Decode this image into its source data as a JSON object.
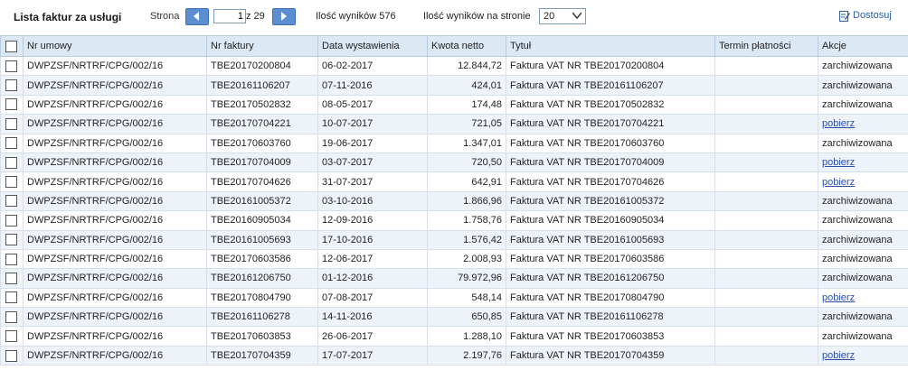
{
  "toolbar": {
    "title": "Lista faktur za usługi",
    "page_label": "Strona",
    "page_value": "1",
    "page_of": "z 29",
    "results": "Ilość wyników 576",
    "per_page_label": "Ilość wyników na stronie",
    "per_page_value": "20",
    "customize_label": "Dostosuj"
  },
  "columns": [
    "Nr umowy",
    "Nr faktury",
    "Data wystawienia",
    "Kwota netto",
    "Tytuł",
    "Termin płatności",
    "Akcje"
  ],
  "rows": [
    {
      "umowa": "DWPZSF/NRTRF/CPG/002/16",
      "faktura": "TBE20170200804",
      "data": "06-02-2017",
      "kwota": "12.844,72",
      "tytul": "Faktura VAT NR TBE20170200804",
      "termin": "",
      "akcja": "zarchiwizowana",
      "link": false
    },
    {
      "umowa": "DWPZSF/NRTRF/CPG/002/16",
      "faktura": "TBE20161106207",
      "data": "07-11-2016",
      "kwota": "424,01",
      "tytul": "Faktura VAT NR TBE20161106207",
      "termin": "",
      "akcja": "zarchiwizowana",
      "link": false
    },
    {
      "umowa": "DWPZSF/NRTRF/CPG/002/16",
      "faktura": "TBE20170502832",
      "data": "08-05-2017",
      "kwota": "174,48",
      "tytul": "Faktura VAT NR TBE20170502832",
      "termin": "",
      "akcja": "zarchiwizowana",
      "link": false
    },
    {
      "umowa": "DWPZSF/NRTRF/CPG/002/16",
      "faktura": "TBE20170704221",
      "data": "10-07-2017",
      "kwota": "721,05",
      "tytul": "Faktura VAT NR TBE20170704221",
      "termin": "",
      "akcja": "pobierz",
      "link": true
    },
    {
      "umowa": "DWPZSF/NRTRF/CPG/002/16",
      "faktura": "TBE20170603760",
      "data": "19-06-2017",
      "kwota": "1.347,01",
      "tytul": "Faktura VAT NR TBE20170603760",
      "termin": "",
      "akcja": "zarchiwizowana",
      "link": false
    },
    {
      "umowa": "DWPZSF/NRTRF/CPG/002/16",
      "faktura": "TBE20170704009",
      "data": "03-07-2017",
      "kwota": "720,50",
      "tytul": "Faktura VAT NR TBE20170704009",
      "termin": "",
      "akcja": "pobierz",
      "link": true
    },
    {
      "umowa": "DWPZSF/NRTRF/CPG/002/16",
      "faktura": "TBE20170704626",
      "data": "31-07-2017",
      "kwota": "642,91",
      "tytul": "Faktura VAT NR TBE20170704626",
      "termin": "",
      "akcja": "pobierz",
      "link": true
    },
    {
      "umowa": "DWPZSF/NRTRF/CPG/002/16",
      "faktura": "TBE20161005372",
      "data": "03-10-2016",
      "kwota": "1.866,96",
      "tytul": "Faktura VAT NR TBE20161005372",
      "termin": "",
      "akcja": "zarchiwizowana",
      "link": false
    },
    {
      "umowa": "DWPZSF/NRTRF/CPG/002/16",
      "faktura": "TBE20160905034",
      "data": "12-09-2016",
      "kwota": "1.758,76",
      "tytul": "Faktura VAT NR TBE20160905034",
      "termin": "",
      "akcja": "zarchiwizowana",
      "link": false
    },
    {
      "umowa": "DWPZSF/NRTRF/CPG/002/16",
      "faktura": "TBE20161005693",
      "data": "17-10-2016",
      "kwota": "1.576,42",
      "tytul": "Faktura VAT NR TBE20161005693",
      "termin": "",
      "akcja": "zarchiwizowana",
      "link": false
    },
    {
      "umowa": "DWPZSF/NRTRF/CPG/002/16",
      "faktura": "TBE20170603586",
      "data": "12-06-2017",
      "kwota": "2.008,93",
      "tytul": "Faktura VAT NR TBE20170603586",
      "termin": "",
      "akcja": "zarchiwizowana",
      "link": false
    },
    {
      "umowa": "DWPZSF/NRTRF/CPG/002/16",
      "faktura": "TBE20161206750",
      "data": "01-12-2016",
      "kwota": "79.972,96",
      "tytul": "Faktura VAT NR TBE20161206750",
      "termin": "",
      "akcja": "zarchiwizowana",
      "link": false
    },
    {
      "umowa": "DWPZSF/NRTRF/CPG/002/16",
      "faktura": "TBE20170804790",
      "data": "07-08-2017",
      "kwota": "548,14",
      "tytul": "Faktura VAT NR TBE20170804790",
      "termin": "",
      "akcja": "pobierz",
      "link": true
    },
    {
      "umowa": "DWPZSF/NRTRF/CPG/002/16",
      "faktura": "TBE20161106278",
      "data": "14-11-2016",
      "kwota": "650,85",
      "tytul": "Faktura VAT NR TBE20161106278",
      "termin": "",
      "akcja": "zarchiwizowana",
      "link": false
    },
    {
      "umowa": "DWPZSF/NRTRF/CPG/002/16",
      "faktura": "TBE20170603853",
      "data": "26-06-2017",
      "kwota": "1.288,10",
      "tytul": "Faktura VAT NR TBE20170603853",
      "termin": "",
      "akcja": "zarchiwizowana",
      "link": false
    },
    {
      "umowa": "DWPZSF/NRTRF/CPG/002/16",
      "faktura": "TBE20170704359",
      "data": "17-07-2017",
      "kwota": "2.197,76",
      "tytul": "Faktura VAT NR TBE20170704359",
      "termin": "",
      "akcja": "pobierz",
      "link": true
    }
  ],
  "icons": {
    "prev": "chevron-left-icon",
    "next": "chevron-right-icon",
    "dropdown": "chevron-down-icon",
    "customize": "edit-icon"
  },
  "colors": {
    "header_bg": "#dde8f5",
    "row_alt_bg": "#eef3fa",
    "nav_button": "#5b8fd1",
    "link": "#2a4fa8"
  }
}
